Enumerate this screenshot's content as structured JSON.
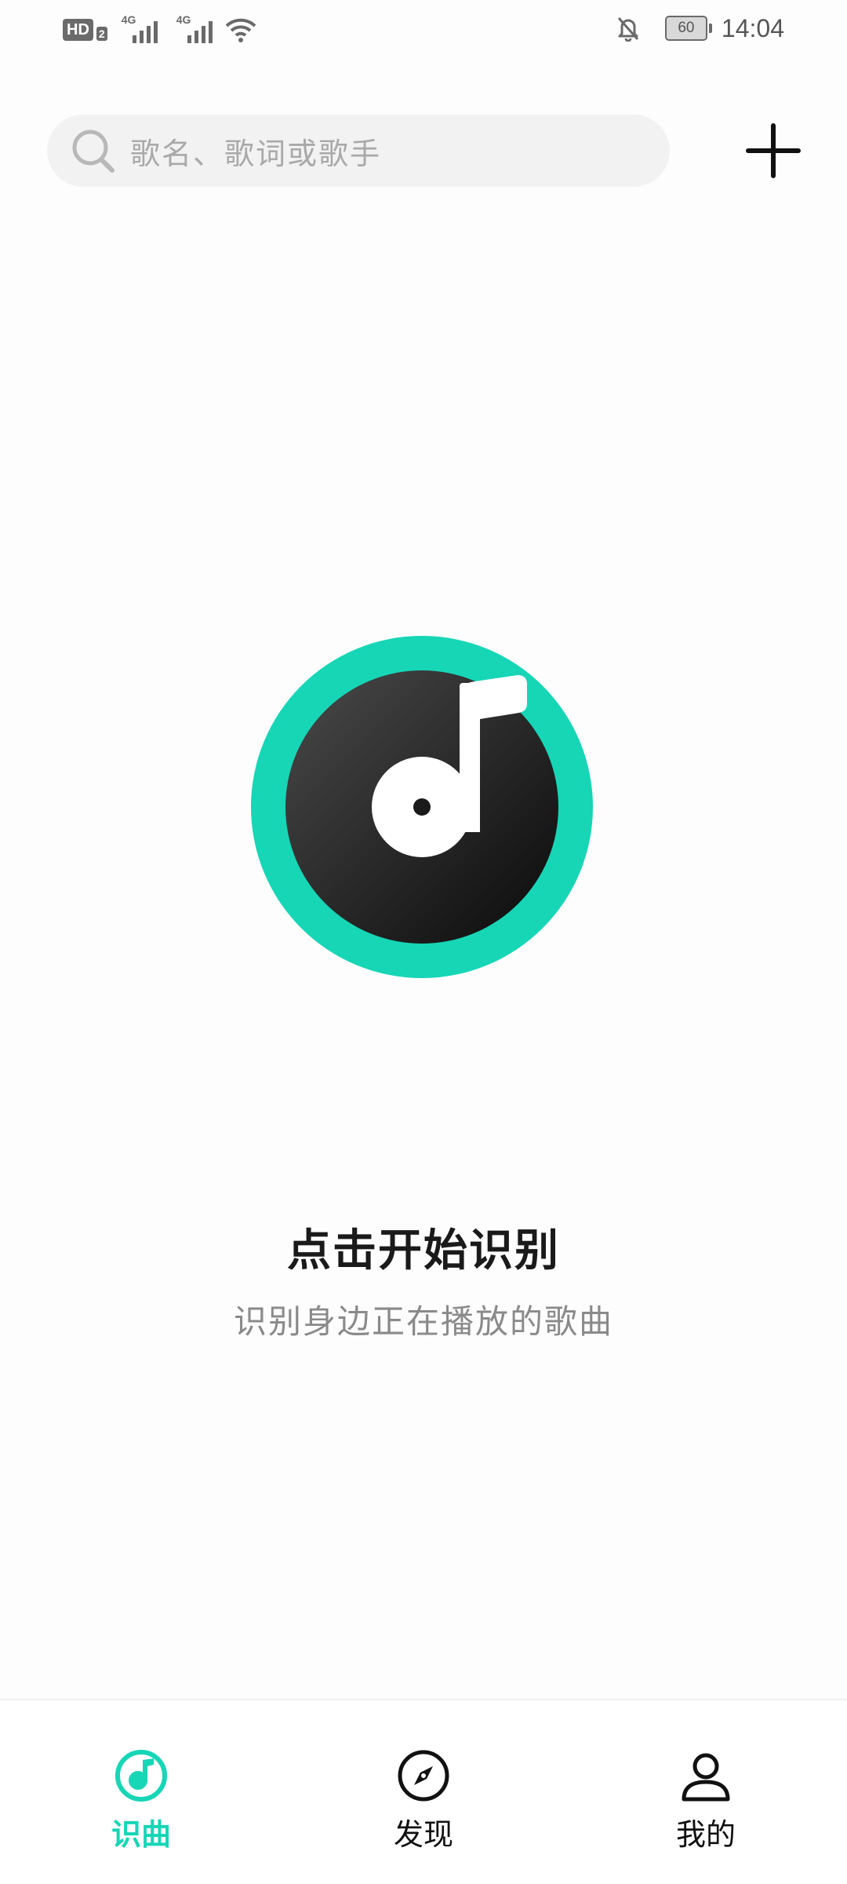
{
  "status_bar": {
    "hd_label": "HD",
    "hd_sub": "2",
    "network_1": "4G",
    "network_2": "4G",
    "battery": "60",
    "time": "14:04"
  },
  "search": {
    "placeholder": "歌名、歌词或歌手"
  },
  "main": {
    "title": "点击开始识别",
    "subtitle": "识别身边正在播放的歌曲"
  },
  "nav": {
    "items": [
      {
        "label": "识曲",
        "active": true
      },
      {
        "label": "发现",
        "active": false
      },
      {
        "label": "我的",
        "active": false
      }
    ]
  },
  "colors": {
    "accent": "#16d6b6",
    "disc": "#1a1a1a",
    "search_bg": "#f2f2f2"
  }
}
